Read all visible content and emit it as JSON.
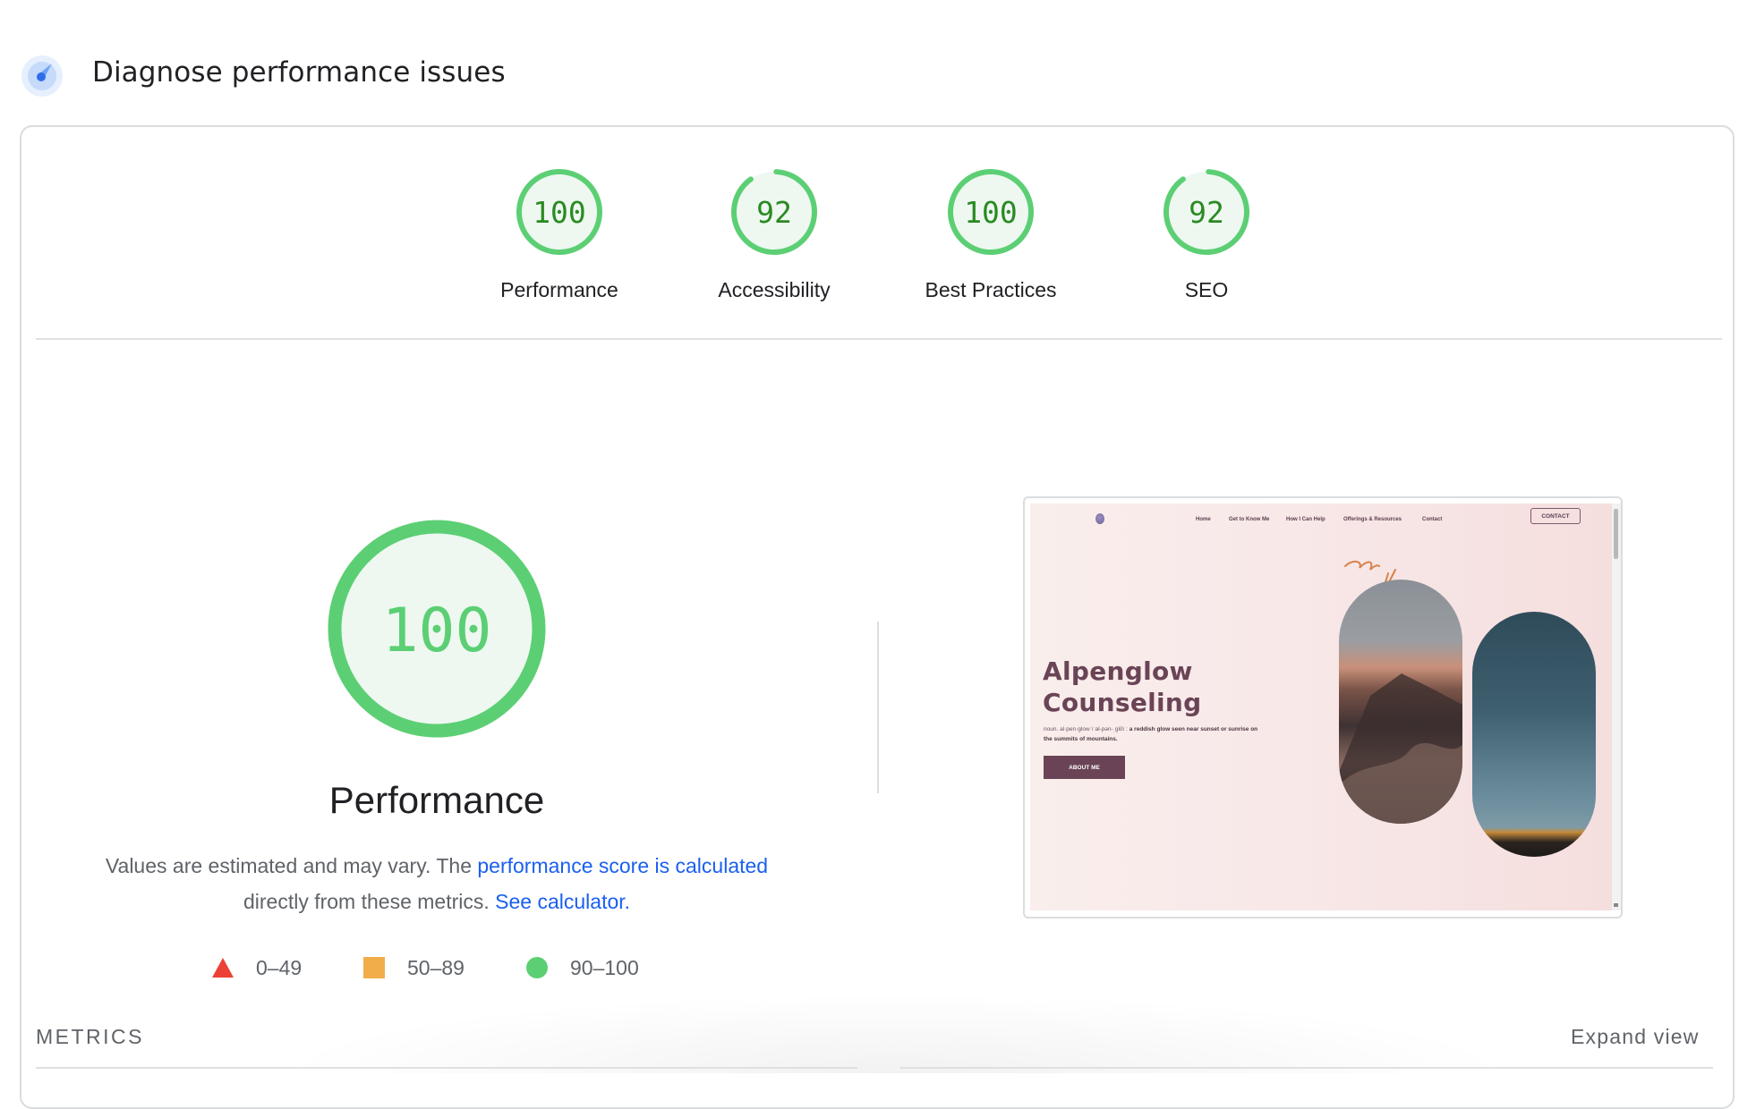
{
  "header": {
    "icon": "lighthouse-gauge-icon",
    "title": "Diagnose performance issues"
  },
  "colors": {
    "pass": "#5ccf74",
    "pass_fill": "#eef8f1",
    "pass_text": "#2a8a22",
    "average": "#f1ad4a",
    "fail": "#ec4236",
    "link": "#1a5ff0"
  },
  "categories": [
    {
      "label": "Performance",
      "score": 100
    },
    {
      "label": "Accessibility",
      "score": 92
    },
    {
      "label": "Best Practices",
      "score": 100
    },
    {
      "label": "SEO",
      "score": 92
    }
  ],
  "performance": {
    "score": 100,
    "title": "Performance",
    "desc_prefix": "Values are estimated and may vary. The ",
    "desc_link1": "performance score is calculated",
    "desc_middle": " directly from these metrics. ",
    "desc_link2": "See calculator."
  },
  "legend": [
    {
      "shape": "triangle-icon",
      "range": "0–49"
    },
    {
      "shape": "square-icon",
      "range": "50–89"
    },
    {
      "shape": "circle-icon",
      "range": "90–100"
    }
  ],
  "screenshot": {
    "nav": [
      "Home",
      "Get to Know Me",
      "How I Can Help",
      "Offerings & Resources",
      "Contact"
    ],
    "contact_button": "CONTACT",
    "title_line1": "Alpenglow",
    "title_line2": "Counseling",
    "definition_light": "noun. al·pen·glow \\ˈal-pən-ˌglō\\ : ",
    "definition_bold": "a reddish glow seen near sunset or sunrise on the summits of mountains.",
    "about_button": "ABOUT ME"
  },
  "metrics": {
    "label": "METRICS",
    "expand_label": "Expand view"
  }
}
